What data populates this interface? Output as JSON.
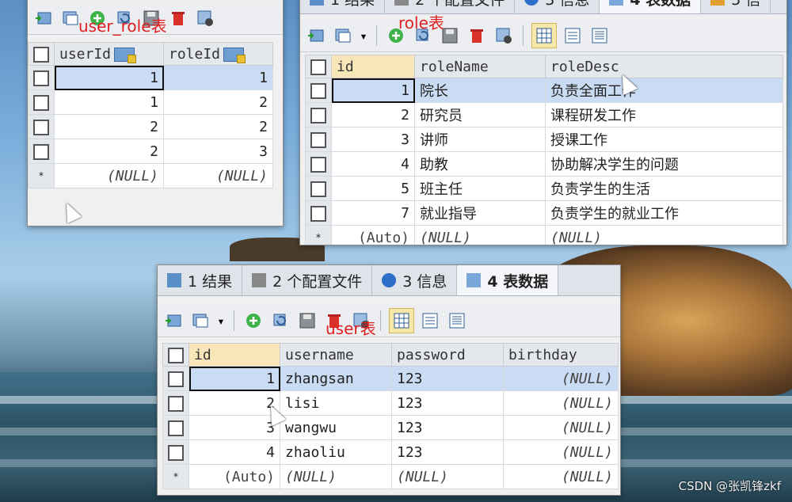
{
  "annotations": {
    "user_role": "user_role表",
    "role": "role表",
    "user": "user表"
  },
  "tabs": [
    {
      "num": "1",
      "label": "结果",
      "text": "1 结果"
    },
    {
      "num": "2",
      "label": "个配置文件",
      "text": "2 个配置文件"
    },
    {
      "num": "3",
      "label": "信息",
      "text": "3 信息"
    },
    {
      "num": "4",
      "label": "表数据",
      "text": "4 表数据"
    }
  ],
  "role_tabs_partial": [
    "1 结果",
    "2 个配置文件",
    "3 信息",
    "4 表数据",
    "5 信"
  ],
  "user_role_table": {
    "columns": [
      "userId",
      "roleId"
    ],
    "rows": [
      [
        "1",
        "1"
      ],
      [
        "1",
        "2"
      ],
      [
        "2",
        "2"
      ],
      [
        "2",
        "3"
      ]
    ],
    "new_row": [
      "(NULL)",
      "(NULL)"
    ],
    "new_marker": "*"
  },
  "role_table": {
    "columns": [
      "id",
      "roleName",
      "roleDesc"
    ],
    "rows": [
      [
        "1",
        "院长",
        "负责全面工作"
      ],
      [
        "2",
        "研究员",
        "课程研发工作"
      ],
      [
        "3",
        "讲师",
        "授课工作"
      ],
      [
        "4",
        "助教",
        "协助解决学生的问题"
      ],
      [
        "5",
        "班主任",
        "负责学生的生活"
      ],
      [
        "7",
        "就业指导",
        "负责学生的就业工作"
      ]
    ],
    "new_row": [
      "(Auto)",
      "(NULL)",
      "(NULL)"
    ],
    "new_marker": "*"
  },
  "user_table": {
    "columns": [
      "id",
      "username",
      "password",
      "birthday"
    ],
    "rows": [
      [
        "1",
        "zhangsan",
        "123",
        "(NULL)"
      ],
      [
        "2",
        "lisi",
        "123",
        "(NULL)"
      ],
      [
        "3",
        "wangwu",
        "123",
        "(NULL)"
      ],
      [
        "4",
        "zhaoliu",
        "123",
        "(NULL)"
      ]
    ],
    "new_row": [
      "(Auto)",
      "(NULL)",
      "(NULL)",
      "(NULL)"
    ],
    "new_marker": "*"
  },
  "watermark": "CSDN @张凯锋zkf",
  "colors": {
    "annotation": "#e02020",
    "selected_row": "#c9dcf3",
    "header_active": "#f8e6b8"
  }
}
